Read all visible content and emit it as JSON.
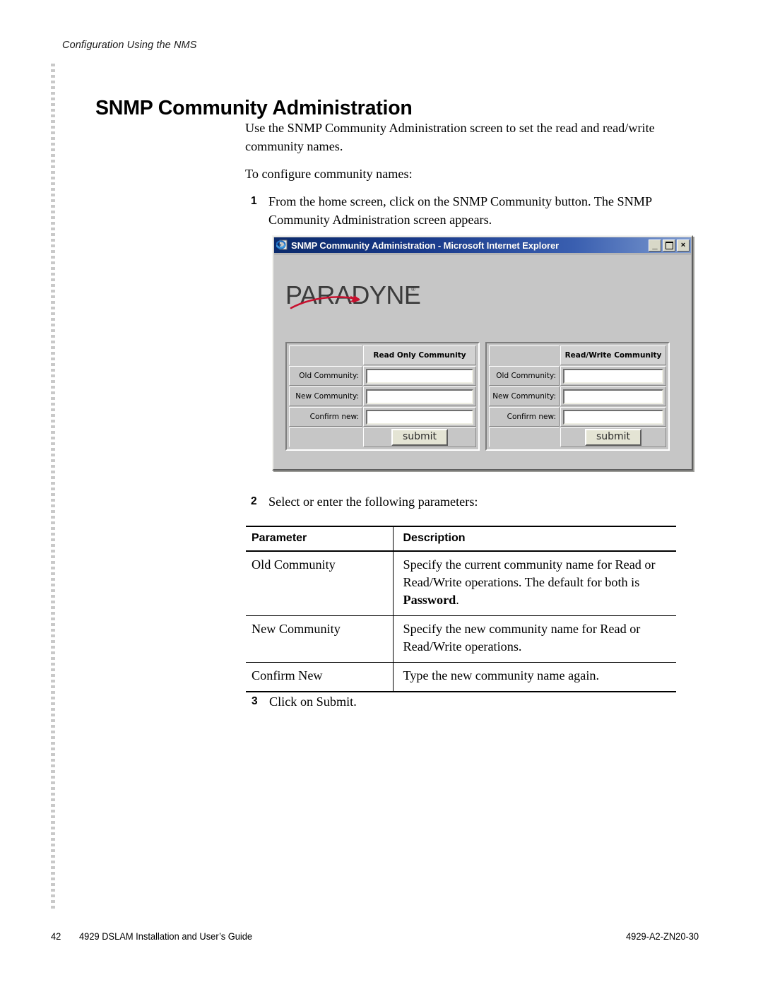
{
  "running_head": "Configuration Using the NMS",
  "page_title": "SNMP Community Administration",
  "intro": {
    "paragraph_1": "Use the SNMP Community Administration screen to set the read and read/write community names.",
    "paragraph_2": "To configure community names:"
  },
  "steps": [
    {
      "number": "1",
      "text": "From the home screen, click on the SNMP Community button. The SNMP Community Administration screen appears."
    },
    {
      "number": "2",
      "text": "Select or enter the following parameters:"
    },
    {
      "number": "3",
      "text": "Click on Submit."
    }
  ],
  "screenshot": {
    "window_title": "SNMP Community Administration - Microsoft Internet Explorer",
    "icons": {
      "app": "internet-explorer-icon",
      "minimize": "minimize-icon",
      "maximize": "maximize-icon",
      "close": "close-icon"
    },
    "window_buttons": {
      "minimize_label": "_",
      "maximize_label": "",
      "close_label": "×"
    },
    "logo": {
      "text": "PARADYNE",
      "trademark": "®",
      "letter_color": "#3b3b3b",
      "swoosh_color": "#c8102e"
    },
    "panels": [
      {
        "heading": "Read Only Community",
        "fields": [
          {
            "label": "Old Community:",
            "value": "",
            "placeholder": ""
          },
          {
            "label": "New Community:",
            "value": "",
            "placeholder": ""
          },
          {
            "label": "Confirm new:",
            "value": "",
            "placeholder": ""
          }
        ],
        "submit_label": "submit"
      },
      {
        "heading": "Read/Write Community",
        "fields": [
          {
            "label": "Old Community:",
            "value": "",
            "placeholder": ""
          },
          {
            "label": "New Community:",
            "value": "",
            "placeholder": ""
          },
          {
            "label": "Confirm new:",
            "value": "",
            "placeholder": ""
          }
        ],
        "submit_label": "submit"
      }
    ]
  },
  "parameter_table": {
    "headers": [
      "Parameter",
      "Description"
    ],
    "rows": [
      {
        "parameter": "Old Community",
        "description_before": "Specify the current community name for Read or Read/Write operations. The default for both is ",
        "description_bold": "Password",
        "description_after": "."
      },
      {
        "parameter": "New Community",
        "description_before": "Specify the new community name for Read or Read/Write operations.",
        "description_bold": "",
        "description_after": ""
      },
      {
        "parameter": "Confirm New",
        "description_before": "Type the new community name again.",
        "description_bold": "",
        "description_after": ""
      }
    ]
  },
  "footer": {
    "page_number": "42",
    "guide_title": "4929 DSLAM Installation and User’s Guide",
    "part_number": "4929-A2-ZN20-30"
  }
}
